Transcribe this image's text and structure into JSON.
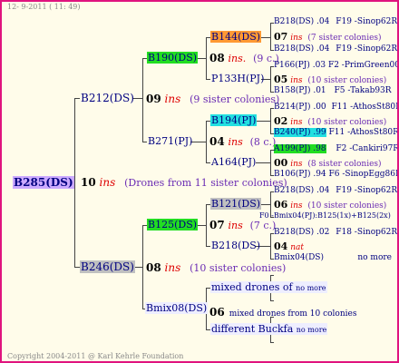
{
  "header": {
    "date": "12- 9-2011 ( 11: 49)"
  },
  "footer": {
    "copyright": "Copyright 2004-2011 @ Karl Kehrle Foundation"
  },
  "colors": {
    "border": "#e0137e",
    "background": "#fffcea",
    "text": "#000080",
    "ins_red": "#dd0000",
    "purple_root": "#ccaaff",
    "green": "#22dd22",
    "orange": "#ff9933",
    "cyan": "#22e0e0",
    "gray": "#c0c0c0"
  },
  "tree": {
    "root": {
      "label": "B285(DS)"
    },
    "root_gen": {
      "num": "10",
      "ins": "ins",
      "note": "(Drones from 11 sister colonies)"
    },
    "queen_line": {
      "label": "B212(DS)",
      "gen_num": "09",
      "gen_ins": "ins",
      "gen_note": "(9 sister colonies)",
      "upper": {
        "label": "B190(DS)",
        "gen_num": "08",
        "gen_ins": "ins.",
        "gen_note": "(9 c.)",
        "queen": "B144(DS)",
        "drone": "P133H(PJ)",
        "queen_rows": [
          {
            "ref": "B218(DS) .04",
            "info": "F19 -Sinop62R"
          },
          {
            "num": "07",
            "ins": "ins",
            "note": "(7 sister colonies)"
          },
          {
            "ref": "B218(DS) .04",
            "info": "F19 -Sinop62R"
          }
        ],
        "drone_rows": [
          {
            "ref": "P166(PJ) .03",
            "info": "F2 -PrimGreen00"
          },
          {
            "num": "05",
            "ins": "ins",
            "note": "(10 sister colonies)"
          },
          {
            "ref": "B158(PJ) .01",
            "info": "F5 -Takab93R"
          }
        ]
      },
      "lower": {
        "label": "B271(PJ)",
        "gen_num": "04",
        "gen_ins": "ins",
        "gen_note": "(8 c.)",
        "queen": "B194(PJ)",
        "drone": "A164(PJ)",
        "queen_rows": [
          {
            "ref": "B214(PJ) .00",
            "info": "F11 -AthosSt80R"
          },
          {
            "num": "02",
            "ins": "ins",
            "note": "(10 sister colonies)"
          },
          {
            "ref": "B240(PJ) .99",
            "info": "F11 -AthosSt80R"
          }
        ],
        "drone_rows": [
          {
            "ref": "A199(PJ) .98",
            "info": "F2 -Cankiri97R"
          },
          {
            "num": "00",
            "ins": "ins",
            "note": "(8 sister colonies)"
          },
          {
            "ref": "B106(PJ) .94",
            "info": "F6 -SinopEgg86R"
          }
        ]
      }
    },
    "drone_line": {
      "label": "B246(DS)",
      "gen_num": "08",
      "gen_ins": "ins",
      "gen_note": "(10 sister colonies)",
      "upper": {
        "label": "B125(DS)",
        "gen_num": "07",
        "gen_ins": "ins",
        "gen_note": "(7 c.)",
        "queen": "B121(DS)",
        "drone": "B218(DS)",
        "queen_rows": [
          {
            "ref": "B218(DS) .04",
            "info": "F19 -Sinop62R"
          },
          {
            "num": "06",
            "ins": "ins",
            "note": "(10 sister colonies)"
          },
          {
            "ref": "F0 -Bmix04(PJ):B125(1x)+B125(2x)"
          }
        ],
        "drone_rows": [
          {
            "ref": "B218(DS) .02",
            "info": "F18 -Sinop62R"
          },
          {
            "num": "04",
            "ins": "nat",
            "note": ""
          },
          {
            "ref": "Bmix04(DS)",
            "info": "no more"
          }
        ]
      },
      "lower": {
        "label": "Bmix08(DS)",
        "gen_num": "06",
        "gen_note": "mixed drones from 10 colonies",
        "mixed": "mixed drones of",
        "different": "different Buckfa",
        "no_more": "no more"
      }
    }
  }
}
